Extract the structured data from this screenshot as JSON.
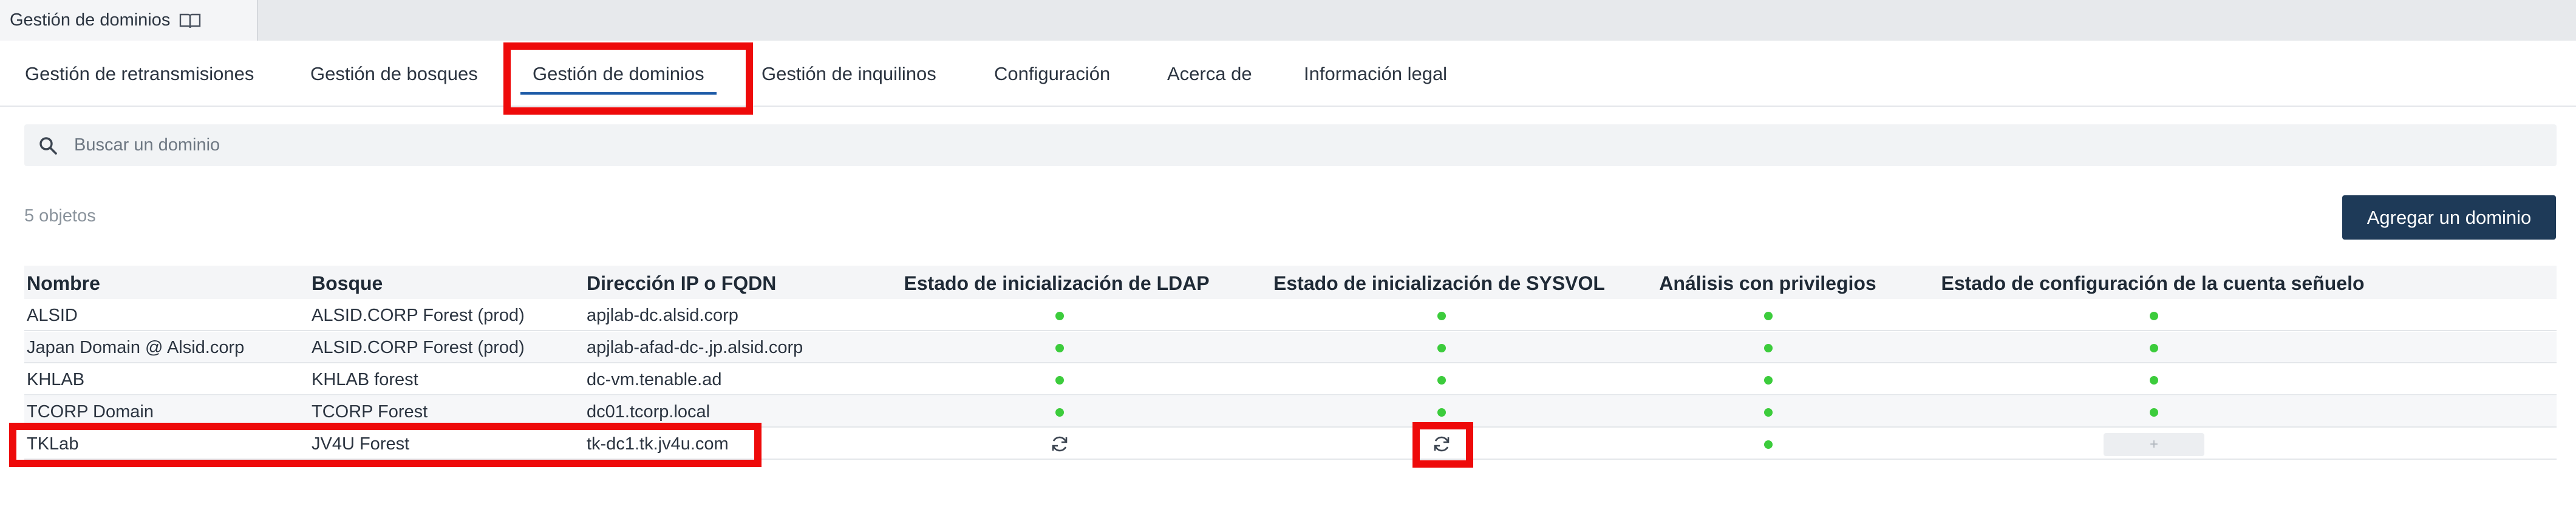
{
  "window_tab": {
    "title": "Gestión de dominios",
    "icon": "book-icon"
  },
  "nav": {
    "tabs": [
      {
        "label": "Gestión de retransmisiones"
      },
      {
        "label": "Gestión de bosques"
      },
      {
        "label": "Gestión de dominios",
        "active": true
      },
      {
        "label": "Gestión de inquilinos"
      },
      {
        "label": "Configuración"
      },
      {
        "label": "Acerca de"
      },
      {
        "label": "Información legal"
      }
    ]
  },
  "search": {
    "placeholder": "Buscar un dominio",
    "icon": "search-icon"
  },
  "count_label": "5 objetos",
  "add_button": "Agregar un dominio",
  "table": {
    "headers": [
      "Nombre",
      "Bosque",
      "Dirección IP o FQDN",
      "Estado de inicialización de LDAP",
      "Estado de inicialización de SYSVOL",
      "Análisis con privilegios",
      "Estado de configuración de la cuenta señuelo"
    ],
    "rows": [
      {
        "name": "ALSID",
        "forest": "ALSID.CORP Forest (prod)",
        "ip": "apjlab-dc.alsid.corp",
        "ldap": "ok",
        "sysvol": "ok",
        "privileged": "ok",
        "decoy": "ok"
      },
      {
        "name": "Japan Domain @ Alsid.corp",
        "forest": "ALSID.CORP Forest (prod)",
        "ip": "apjlab-afad-dc-.jp.alsid.corp",
        "ldap": "ok",
        "sysvol": "ok",
        "privileged": "ok",
        "decoy": "ok"
      },
      {
        "name": "KHLAB",
        "forest": "KHLAB forest",
        "ip": "dc-vm.tenable.ad",
        "ldap": "ok",
        "sysvol": "ok",
        "privileged": "ok",
        "decoy": "ok"
      },
      {
        "name": "TCORP Domain",
        "forest": "TCORP Forest",
        "ip": "dc01.tcorp.local",
        "ldap": "ok",
        "sysvol": "ok",
        "privileged": "ok",
        "decoy": "ok"
      },
      {
        "name": "TKLab",
        "forest": "JV4U Forest",
        "ip": "tk-dc1.tk.jv4u.com",
        "ldap": "syncing",
        "sysvol": "syncing",
        "privileged": "ok",
        "decoy": "add"
      }
    ]
  },
  "colors": {
    "ok_dot": "#3ccc3c",
    "highlight": "#ee0a0a",
    "button": "#1e3a58",
    "active_tab": "#1c5aa6"
  },
  "plus_label": "+"
}
